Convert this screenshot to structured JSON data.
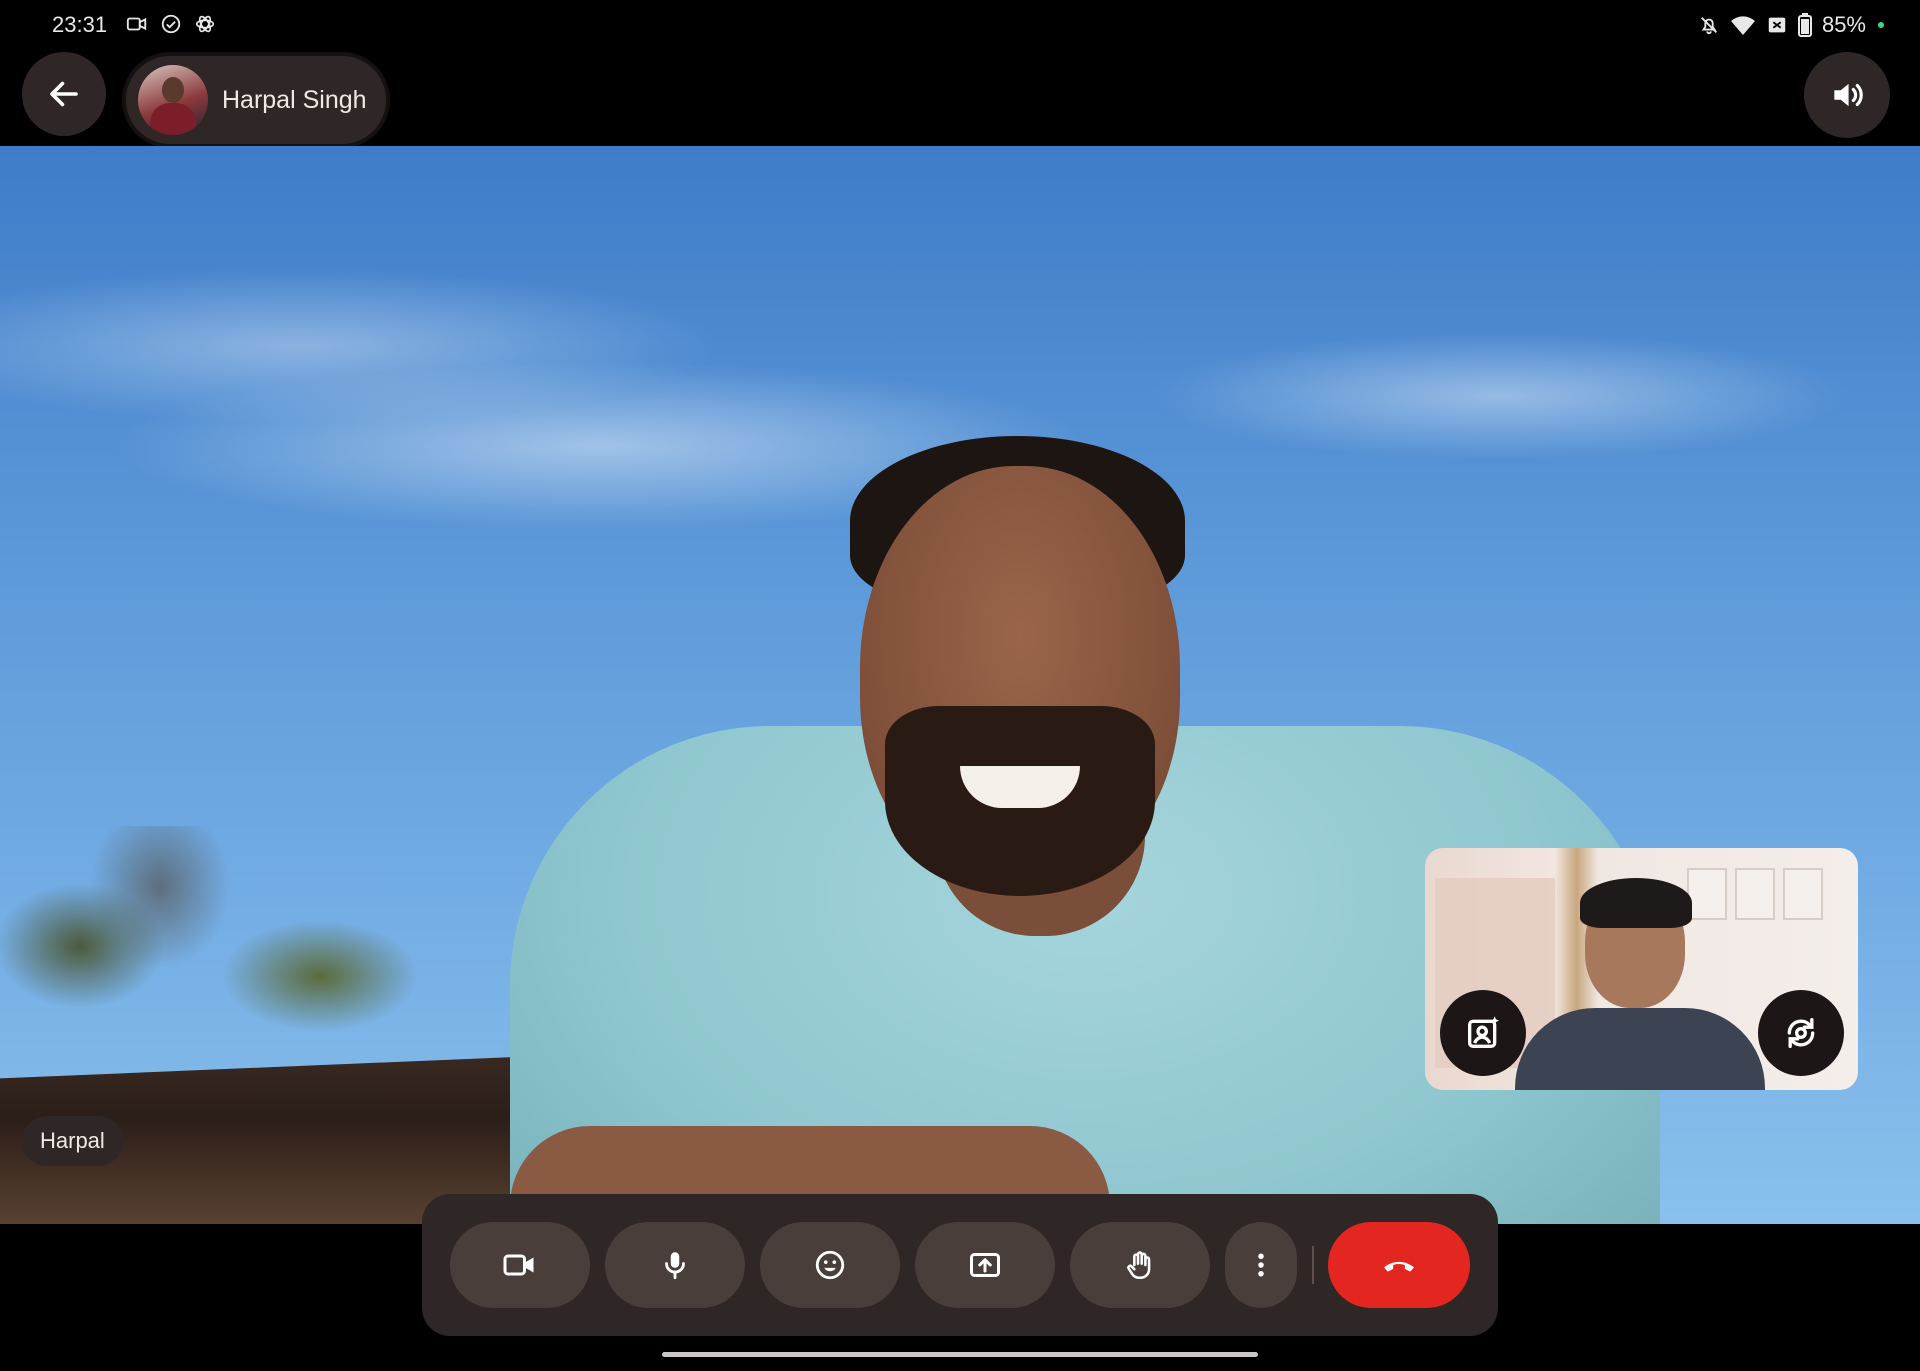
{
  "status_bar": {
    "time": "23:31",
    "left_icons": [
      "video-icon",
      "check-circle-icon",
      "openai-icon"
    ],
    "right_icons": [
      "bell-off-icon",
      "wifi-icon",
      "sim-x-icon",
      "battery-icon"
    ],
    "battery": "85%"
  },
  "top_bar": {
    "contact_name": "Harpal Singh",
    "icons": {
      "back": "arrow-left-icon",
      "speaker": "speaker-icon"
    }
  },
  "main_video": {
    "participant_label": "Harpal"
  },
  "self_view": {
    "icons": [
      "effects-icon",
      "flip-camera-icon"
    ]
  },
  "controls": {
    "buttons": [
      {
        "icon": "video-camera-icon"
      },
      {
        "icon": "microphone-icon"
      },
      {
        "icon": "emoji-icon"
      },
      {
        "icon": "share-screen-icon"
      },
      {
        "icon": "raise-hand-icon"
      },
      {
        "icon": "more-vertical-icon"
      },
      {
        "icon": "end-call-icon"
      }
    ],
    "colors": {
      "end_call": "#e3261f",
      "bar_bg": "#2f2725",
      "button_bg": "#4a3e3b"
    }
  }
}
